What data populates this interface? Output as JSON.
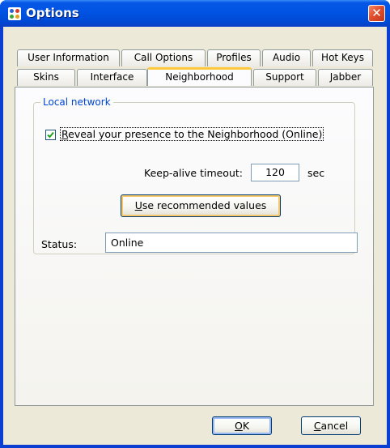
{
  "window": {
    "title": "Options",
    "close_glyph": "✕",
    "icon": "neighborhood-app-icon"
  },
  "tabs": {
    "row1": [
      "User Information",
      "Call Options",
      "Profiles",
      "Audio",
      "Hot Keys"
    ],
    "row2": [
      "Skins",
      "Interface",
      "Neighborhood",
      "Support",
      "Jabber"
    ],
    "active": "Neighborhood"
  },
  "local_network": {
    "group_label": "Local network",
    "reveal_checkbox": {
      "mnemonic": "R",
      "rest": "eveal your presence to the Neighborhood (Online)",
      "checked": true
    },
    "keepalive": {
      "label": "Keep-alive timeout:",
      "value": "120",
      "unit": "sec"
    },
    "recommended_button": {
      "mnemonic": "U",
      "rest": "se recommended values"
    },
    "status": {
      "label": "Status:",
      "value": "Online"
    }
  },
  "footer": {
    "ok": {
      "mnemonic": "O",
      "rest": "K"
    },
    "cancel": {
      "mnemonic": "C",
      "rest": "ancel"
    }
  },
  "colors": {
    "titlebar": "#0054e3",
    "accent_tab": "#ffc83c",
    "group_label": "#0046d5",
    "dialog_face": "#ece9d8"
  }
}
